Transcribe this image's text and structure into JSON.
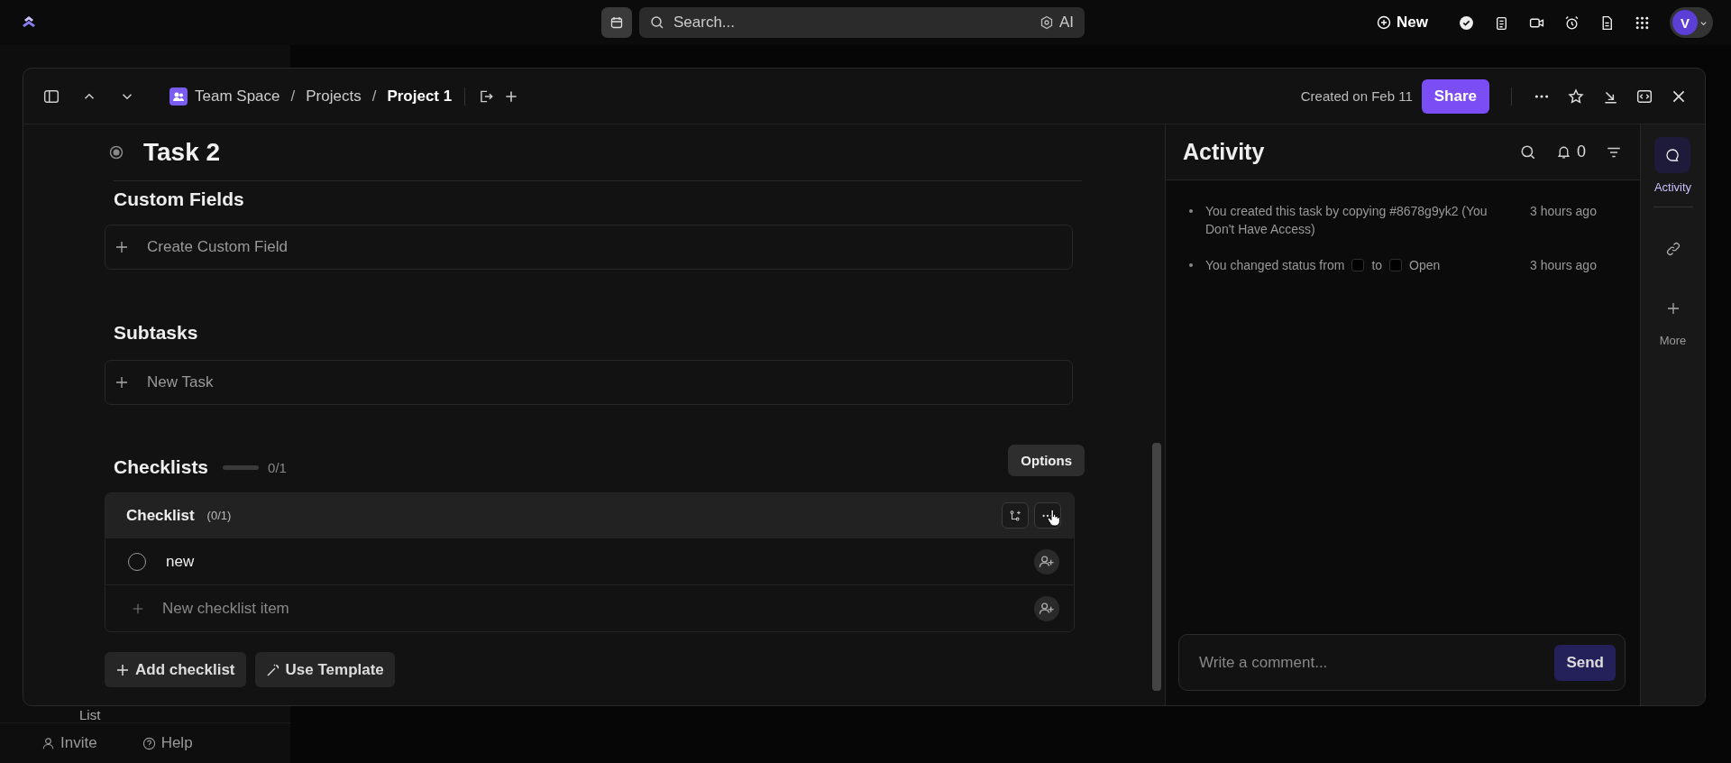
{
  "top_bar": {
    "search": {
      "placeholder": "Search..."
    },
    "ai_label": "AI",
    "new_button": "New",
    "avatar": "V"
  },
  "background_sidebar": {
    "items": [
      {
        "label": "List"
      }
    ],
    "footer": [
      "Invite",
      "Help"
    ]
  },
  "modal": {
    "breadcrumb": [
      {
        "label": "Team Space",
        "kind": "space",
        "selected": false
      },
      {
        "separator_before": "/",
        "label": "Projects",
        "kind": "folder",
        "selected": false
      },
      {
        "separator_before": "/",
        "label": "Project 1",
        "kind": "list",
        "selected": true
      }
    ],
    "created": "Created on Feb 11",
    "share_button": "Share",
    "task": {
      "title": "Task 2",
      "custom_fields": {
        "heading": "Custom Fields",
        "action": "Create Custom Field"
      },
      "subtasks": {
        "heading": "Subtasks",
        "action": "New Task"
      },
      "checklists": {
        "heading": "Checklists",
        "level": 0,
        "reading": "0/1",
        "checklist": {
          "name": "Checklist",
          "count": "(0/1)",
          "items": [
            {
              "label": "new",
              "checked": false
            }
          ],
          "new_item_placeholder": "New checklist item"
        },
        "tooltip": "Options"
      },
      "buttons": [
        {
          "label": "Add checklist",
          "kind": "add"
        },
        {
          "label": "Use Template",
          "kind": "template"
        }
      ]
    },
    "activity": {
      "title": "Activity",
      "notification_count": "0",
      "entries": [
        {
          "kind": "text",
          "text": "You created this task by copying #8678g9yk2 (You Don't Have Access)",
          "time": "3 hours ago"
        },
        {
          "kind": "status_change",
          "prefix": "You changed status from",
          "middle": "to",
          "status": "Open",
          "time": "3 hours ago"
        }
      ],
      "comment": {
        "placeholder": "Write a comment...",
        "send": "Send"
      }
    },
    "rail": [
      {
        "kind": "activity",
        "label": "Activity",
        "selected": true
      },
      {
        "kind": "link",
        "selected": false
      },
      {
        "kind": "more",
        "label": "More",
        "selected": false
      }
    ]
  }
}
